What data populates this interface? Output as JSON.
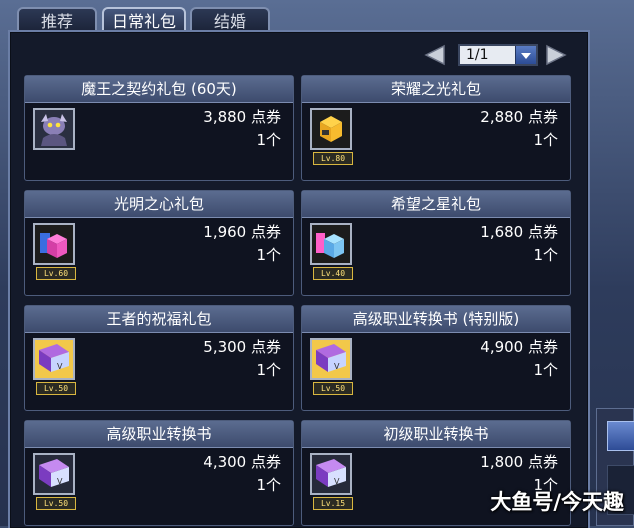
{
  "tabs": [
    {
      "label": "推荐",
      "active": false
    },
    {
      "label": "日常礼包",
      "active": true
    },
    {
      "label": "结婚",
      "active": false
    }
  ],
  "pager": {
    "page": "1/1",
    "prev_icon": "triangle-left-icon",
    "next_icon": "triangle-right-icon"
  },
  "items": [
    {
      "name": "魔王之契约礼包 (60天)",
      "price": "3,880 点券",
      "qty": "1个",
      "level": "",
      "icon": "demon-king-icon"
    },
    {
      "name": "荣耀之光礼包",
      "price": "2,880 点券",
      "qty": "1个",
      "level": "Lv.80",
      "icon": "gold-gift-box-icon"
    },
    {
      "name": "光明之心礼包",
      "price": "1,960 点券",
      "qty": "1个",
      "level": "Lv.60",
      "icon": "pink-gift-box-icon"
    },
    {
      "name": "希望之星礼包",
      "price": "1,680 点券",
      "qty": "1个",
      "level": "Lv.40",
      "icon": "blue-gift-box-icon"
    },
    {
      "name": "王者的祝福礼包",
      "price": "5,300 点券",
      "qty": "1个",
      "level": "Lv.50",
      "icon": "gold-book-icon"
    },
    {
      "name": "高级职业转换书 (特别版)",
      "price": "4,900 点券",
      "qty": "1个",
      "level": "Lv.50",
      "icon": "gold-book-icon"
    },
    {
      "name": "高级职业转换书",
      "price": "4,300 点券",
      "qty": "1个",
      "level": "Lv.50",
      "icon": "purple-book-icon"
    },
    {
      "name": "初级职业转换书",
      "price": "1,800 点券",
      "qty": "1个",
      "level": "Lv.15",
      "icon": "purple-book-icon"
    }
  ],
  "watermark": "大鱼号/今天趣",
  "colors": {
    "panel_bg": "#141a2a",
    "card_title_bg": "#4d5d80",
    "price_text": "#ffffff",
    "level_badge": "#ffe27a"
  }
}
